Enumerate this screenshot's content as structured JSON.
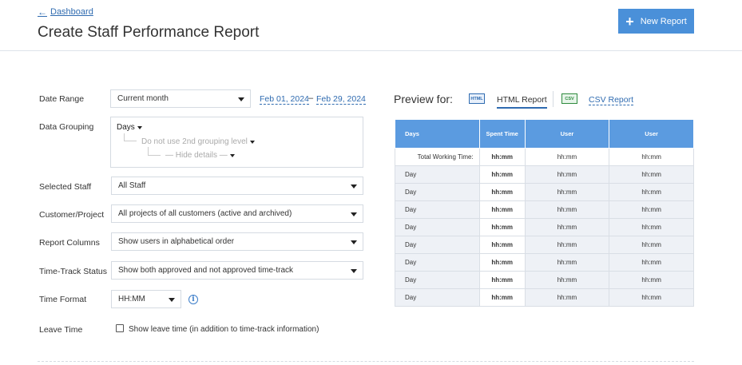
{
  "header": {
    "back_label": "Dashboard",
    "title": "Create Staff Performance Report",
    "new_report_label": "New Report"
  },
  "form": {
    "date_range": {
      "label": "Date Range",
      "value": "Current month",
      "from": "Feb 01, 2024",
      "separator": "–",
      "to": "Feb 29, 2024"
    },
    "data_grouping": {
      "label": "Data Grouping",
      "level1": "Days",
      "level2": "Do not use 2nd grouping level",
      "level3": "— Hide details —"
    },
    "selected_staff": {
      "label": "Selected Staff",
      "value": "All Staff"
    },
    "customer_project": {
      "label": "Customer/Project",
      "value": "All projects of all customers (active and archived)"
    },
    "report_columns": {
      "label": "Report Columns",
      "value": "Show users in alphabetical order"
    },
    "time_track_status": {
      "label": "Time-Track Status",
      "value": "Show both approved and not approved time-track"
    },
    "time_format": {
      "label": "Time Format",
      "value": "HH:MM",
      "info_icon": "info-icon"
    },
    "leave_time": {
      "label": "Leave Time",
      "checkbox_label": "Show leave time (in addition to time-track information)",
      "checked": false
    }
  },
  "preview": {
    "label": "Preview for:",
    "tabs": [
      {
        "label": "HTML Report",
        "icon_text": "HTML",
        "active": true
      },
      {
        "label": "CSV Report",
        "icon_text": "CSV",
        "active": false
      }
    ],
    "table": {
      "headers": [
        "Days",
        "Spent Time",
        "User",
        "User"
      ],
      "total_row": [
        "Total Working Time:",
        "hh:mm",
        "hh:mm",
        "hh:mm"
      ],
      "rows": [
        [
          "Day",
          "hh:mm",
          "hh:mm",
          "hh:mm"
        ],
        [
          "Day",
          "hh:mm",
          "hh:mm",
          "hh:mm"
        ],
        [
          "Day",
          "hh:mm",
          "hh:mm",
          "hh:mm"
        ],
        [
          "Day",
          "hh:mm",
          "hh:mm",
          "hh:mm"
        ],
        [
          "Day",
          "hh:mm",
          "hh:mm",
          "hh:mm"
        ],
        [
          "Day",
          "hh:mm",
          "hh:mm",
          "hh:mm"
        ],
        [
          "Day",
          "hh:mm",
          "hh:mm",
          "hh:mm"
        ],
        [
          "Day",
          "hh:mm",
          "hh:mm",
          "hh:mm"
        ]
      ]
    }
  },
  "colors": {
    "accent": "#4a90d9",
    "link": "#2f6bb0",
    "table_header": "#5b9be0"
  }
}
